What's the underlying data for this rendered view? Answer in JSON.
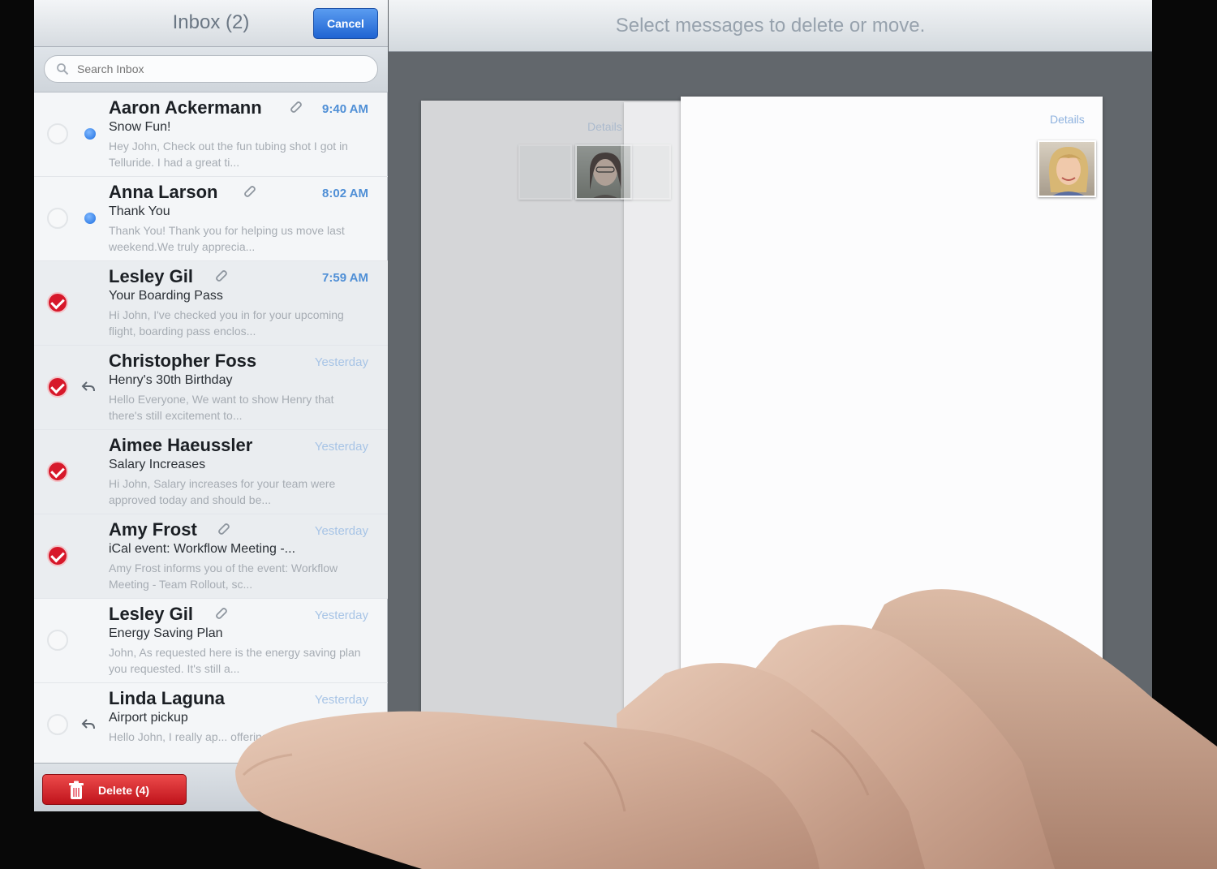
{
  "left_pane": {
    "title": "Inbox (2)",
    "cancel_label": "Cancel",
    "search_placeholder": "Search Inbox",
    "messages": [
      {
        "sender": "Aaron Ackermann",
        "time": "9:40 AM",
        "subject": "Snow Fun!",
        "preview": "Hey John, Check out the fun tubing shot I got in Telluride. I had a great ti...",
        "attachment": true,
        "unread": true,
        "replied": false,
        "selected": false
      },
      {
        "sender": "Anna Larson",
        "time": "8:02 AM",
        "subject": "Thank You",
        "preview": "Thank You! Thank you for helping us move last weekend.We truly apprecia...",
        "attachment": true,
        "unread": true,
        "replied": false,
        "selected": false
      },
      {
        "sender": "Lesley Gil",
        "time": "7:59 AM",
        "subject": "Your Boarding Pass",
        "preview": "Hi John, I've checked you in for your upcoming flight, boarding pass enclos...",
        "attachment": true,
        "unread": false,
        "replied": false,
        "selected": true
      },
      {
        "sender": "Christopher Foss",
        "time": "Yesterday",
        "subject": "Henry's 30th Birthday",
        "preview": "Hello Everyone, We want to show Henry that there's still excitement to...",
        "attachment": false,
        "unread": false,
        "replied": true,
        "selected": true
      },
      {
        "sender": "Aimee Haeussler",
        "time": "Yesterday",
        "subject": "Salary Increases",
        "preview": "Hi John, Salary increases for your team were approved today and should be...",
        "attachment": false,
        "unread": false,
        "replied": false,
        "selected": true
      },
      {
        "sender": "Amy Frost",
        "time": "Yesterday",
        "subject": "iCal event: Workflow Meeting -...",
        "preview": "Amy Frost informs you of the event: Workflow Meeting - Team Rollout, sc...",
        "attachment": true,
        "unread": false,
        "replied": false,
        "selected": true
      },
      {
        "sender": "Lesley Gil",
        "time": "Yesterday",
        "subject": "Energy Saving Plan",
        "preview": "John, As requested here is the energy saving plan you requested. It's still a...",
        "attachment": true,
        "unread": false,
        "replied": false,
        "selected": false
      },
      {
        "sender": "Linda Laguna",
        "time": "Yesterday",
        "subject": "Airport pickup",
        "preview": "Hello John, I really ap... offering to pick me...",
        "attachment": false,
        "unread": false,
        "replied": true,
        "selected": false
      }
    ],
    "delete_label": "Delete (4)"
  },
  "right_pane": {
    "header_text": "Select messages to delete or move.",
    "details_back": "Details",
    "details_front": "Details"
  },
  "colors": {
    "accent_blue": "#1f64d2",
    "delete_red": "#c0131b",
    "check_red": "#d7182a",
    "time_blue": "#4f8fd6"
  },
  "icons": [
    "search-icon",
    "attachment-icon",
    "unread-dot-icon",
    "reply-icon",
    "checkmark-icon",
    "trash-icon"
  ]
}
